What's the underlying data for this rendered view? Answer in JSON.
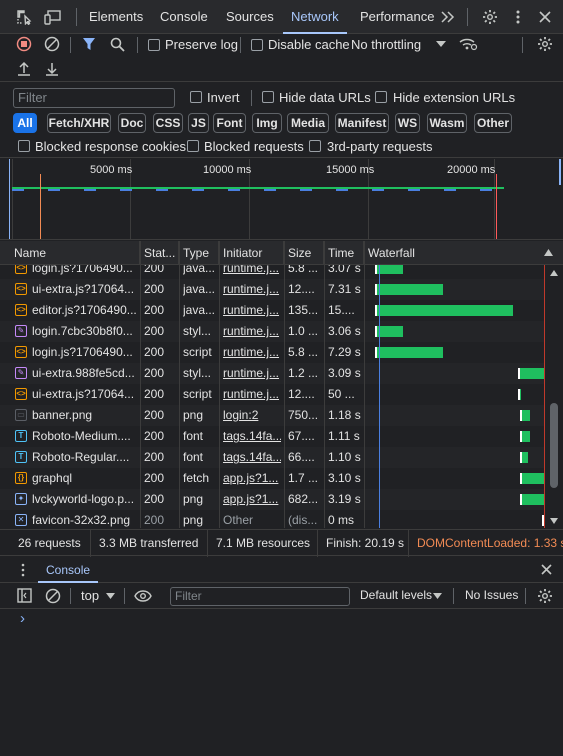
{
  "tabs": {
    "items": [
      "Elements",
      "Console",
      "Sources",
      "Network",
      "Performance"
    ],
    "active": "Network"
  },
  "toolbar": {
    "preserve_log": "Preserve log",
    "disable_cache": "Disable cache",
    "throttling": "No throttling"
  },
  "filter": {
    "placeholder": "Filter",
    "invert": "Invert",
    "hide_data_urls": "Hide data URLs",
    "hide_extension_urls": "Hide extension URLs"
  },
  "chips": [
    "All",
    "Fetch/XHR",
    "Doc",
    "CSS",
    "JS",
    "Font",
    "Img",
    "Media",
    "Manifest",
    "WS",
    "Wasm",
    "Other"
  ],
  "blocked": {
    "cookies": "Blocked response cookies",
    "requests": "Blocked requests",
    "third_party": "3rd-party requests"
  },
  "overview": {
    "ticks": [
      "5000 ms",
      "10000 ms",
      "15000 ms",
      "20000 ms"
    ]
  },
  "columns": [
    "Name",
    "Stat...",
    "Type",
    "Initiator",
    "Size",
    "Time",
    "Waterfall"
  ],
  "rows": [
    {
      "name": "login.js?1706490...",
      "status": "200",
      "type": "java...",
      "initiator": "runtime.j...",
      "size": "5.8 ...",
      "time": "3.07 s",
      "icon": "js-icon",
      "bar_start": 0.03,
      "bar_width": 0.16
    },
    {
      "name": "ui-extra.js?17064...",
      "status": "200",
      "type": "java...",
      "initiator": "runtime.j...",
      "size": "12....",
      "time": "7.31 s",
      "icon": "js-icon",
      "bar_start": 0.03,
      "bar_width": 0.39
    },
    {
      "name": "editor.js?1706490...",
      "status": "200",
      "type": "java...",
      "initiator": "runtime.j...",
      "size": "135...",
      "time": "15....",
      "icon": "js-icon",
      "bar_start": 0.03,
      "bar_width": 0.79
    },
    {
      "name": "login.7cbc30b8f0...",
      "status": "200",
      "type": "styl...",
      "initiator": "runtime.j...",
      "size": "1.0 ...",
      "time": "3.06 s",
      "icon": "css-icon",
      "bar_start": 0.03,
      "bar_width": 0.16
    },
    {
      "name": "login.js?1706490...",
      "status": "200",
      "type": "script",
      "initiator": "runtime.j...",
      "size": "5.8 ...",
      "time": "7.29 s",
      "icon": "js-icon",
      "bar_start": 0.03,
      "bar_width": 0.39
    },
    {
      "name": "ui-extra.988fe5cd...",
      "status": "200",
      "type": "styl...",
      "initiator": "runtime.j...",
      "size": "1.2 ...",
      "time": "3.09 s",
      "icon": "css-icon",
      "bar_start": 0.85,
      "bar_width": 0.15
    },
    {
      "name": "ui-extra.js?17064...",
      "status": "200",
      "type": "script",
      "initiator": "runtime.j...",
      "size": "12....",
      "time": "50 ...",
      "icon": "js-icon",
      "bar_start": 0.85,
      "bar_width": 0.01
    },
    {
      "name": "banner.png",
      "status": "200",
      "type": "png",
      "initiator": "login:2",
      "size": "750...",
      "time": "1.18 s",
      "icon": "image-icon",
      "bar_start": 0.86,
      "bar_width": 0.06
    },
    {
      "name": "Roboto-Medium....",
      "status": "200",
      "type": "font",
      "initiator": "tags.14fa...",
      "size": "67....",
      "time": "1.11 s",
      "icon": "font-icon",
      "bar_start": 0.86,
      "bar_width": 0.06
    },
    {
      "name": "Roboto-Regular....",
      "status": "200",
      "type": "font",
      "initiator": "tags.14fa...",
      "size": "66....",
      "time": "1.10 s",
      "icon": "font-icon",
      "bar_start": 0.86,
      "bar_width": 0.05
    },
    {
      "name": "graphql",
      "status": "200",
      "type": "fetch",
      "initiator": "app.js?1...",
      "size": "1.7 ...",
      "time": "3.10 s",
      "icon": "fetch-icon",
      "bar_start": 0.86,
      "bar_width": 0.14
    },
    {
      "name": "lvckyworld-logo.p...",
      "status": "200",
      "type": "png",
      "initiator": "app.js?1...",
      "size": "682...",
      "time": "3.19 s",
      "icon": "logo-icon",
      "bar_start": 0.86,
      "bar_width": 0.14
    },
    {
      "name": "favicon-32x32.png",
      "status": "200",
      "type": "png",
      "initiator": "Other",
      "size": "(dis...",
      "time": "0 ms",
      "icon": "favicon-icon",
      "bar_start": 0.99,
      "bar_width": 0.01
    }
  ],
  "status_bar": {
    "requests": "26 requests",
    "transferred": "3.3 MB transferred",
    "resources": "7.1 MB resources",
    "finish": "Finish: 20.19 s",
    "dom": "DOMContentLoaded: 1.33 s"
  },
  "drawer": {
    "tab": "Console",
    "context": "top",
    "filter_placeholder": "Filter",
    "levels": "Default levels",
    "issues": "No Issues",
    "prompt": "›"
  },
  "colors": {
    "accent": "#a8c7fa",
    "bar": "#1fbf5f",
    "dom_orange": "#f28b54"
  }
}
